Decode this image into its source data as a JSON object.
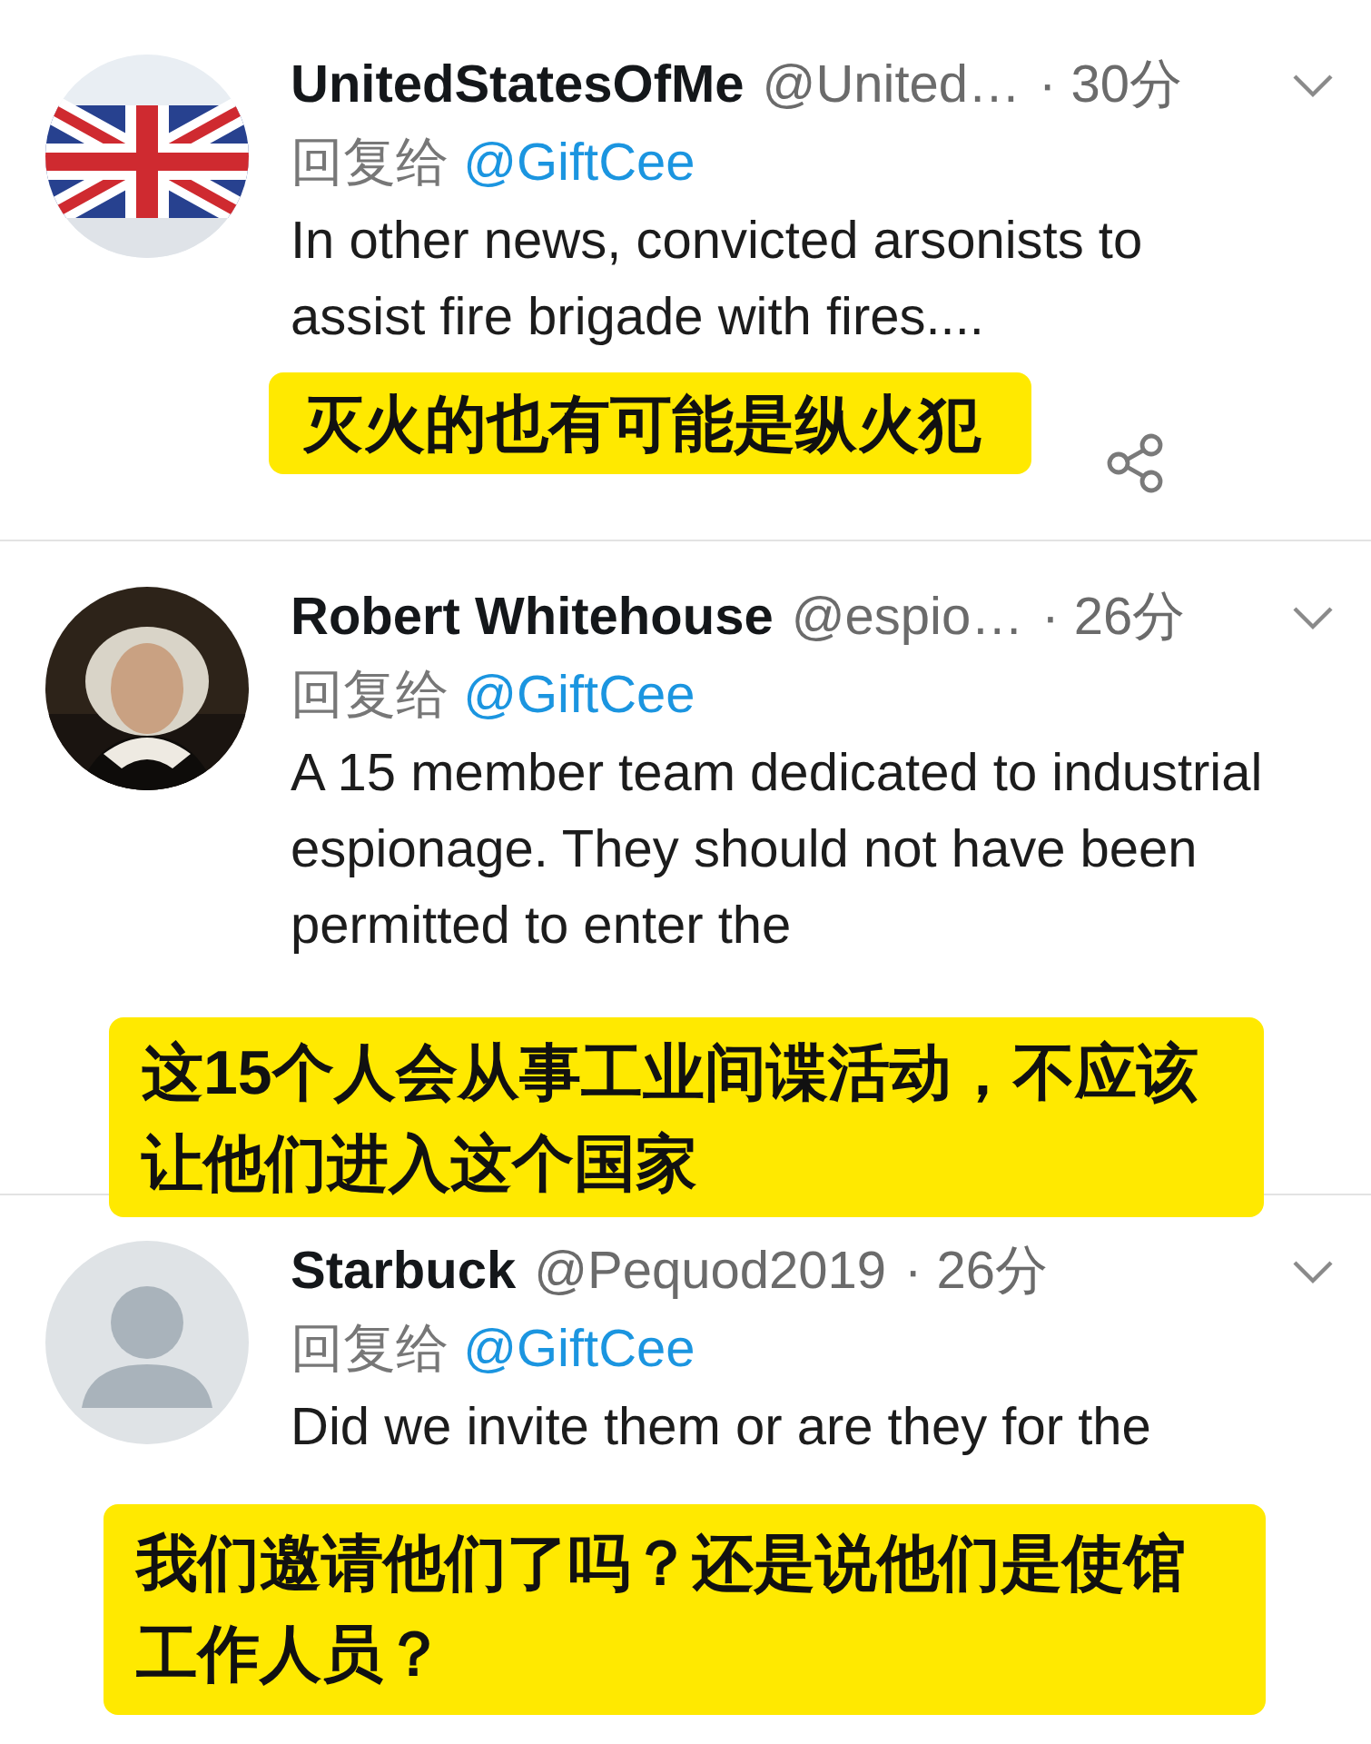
{
  "tweets": [
    {
      "name": "UnitedStatesOfMe",
      "handle": "@United…",
      "time": "· 30分",
      "reply_label": "回复给",
      "reply_to": "@GiftCee",
      "body": "In other news, convicted arsonists to assist fire brigade with fires....",
      "caption": "灭火的也有可能是纵火犯",
      "share": true
    },
    {
      "name": "Robert Whitehouse",
      "handle": "@espio…",
      "time": "· 26分",
      "reply_label": "回复给",
      "reply_to": "@GiftCee",
      "body": "A 15 member team dedicated to industrial espionage. They should not have been permitted to enter the",
      "caption": "这15个人会从事工业间谍活动，不应该让他们进入这个国家",
      "share": false
    },
    {
      "avatar": {
        "kind": "default"
      },
      "name": "Starbuck",
      "handle": "@Pequod2019",
      "time": "· 26分",
      "reply_label": "回复给",
      "reply_to": "@GiftCee",
      "body": "Did we invite them or are they for the",
      "caption": "我们邀请他们了吗？还是说他们是使馆工作人员？",
      "share": false
    }
  ]
}
